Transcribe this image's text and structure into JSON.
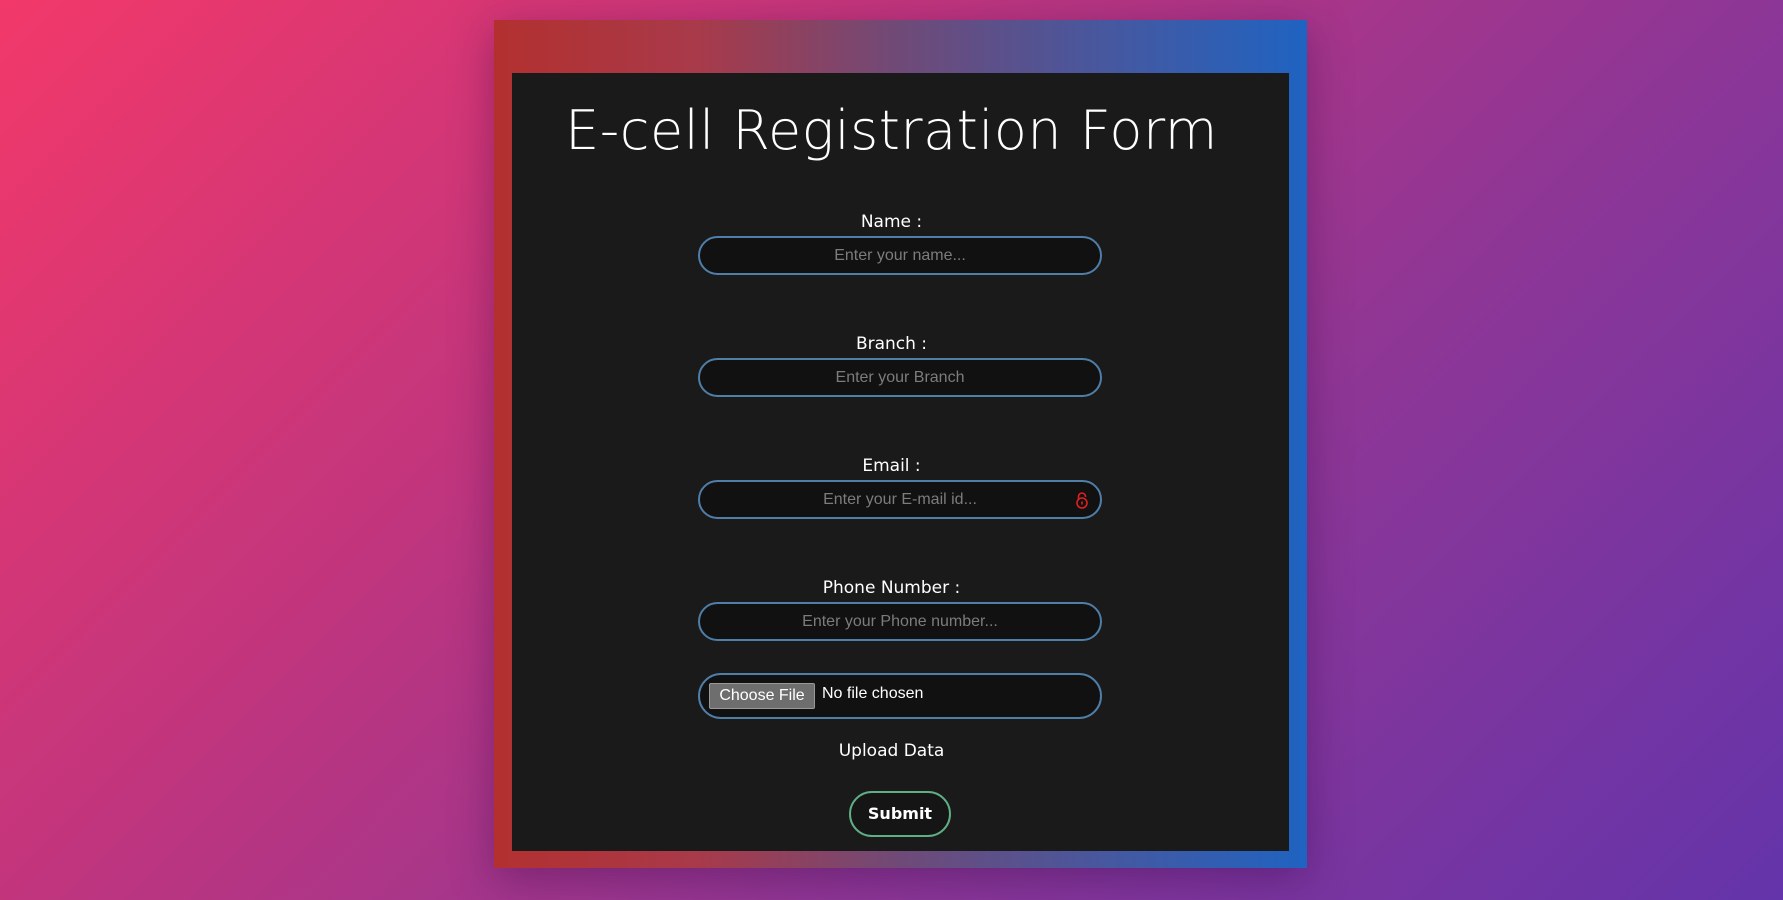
{
  "form": {
    "title": "E-cell Registration Form",
    "fields": [
      {
        "label": "Name :",
        "placeholder": "Enter your name..."
      },
      {
        "label": "Branch :",
        "placeholder": "Enter your Branch"
      },
      {
        "label": "Email :",
        "placeholder": "Enter your E-mail id..."
      },
      {
        "label": "Phone Number :",
        "placeholder": "Enter your Phone number..."
      }
    ],
    "file": {
      "button_label": "Choose File",
      "status": "No file chosen"
    },
    "upload_label": "Upload Data",
    "submit_label": "Submit"
  },
  "colors": {
    "card_background": "#1a1a1a",
    "input_border": "#4f7ea8",
    "submit_border": "#5fae86",
    "lock_icon": "#e02020"
  },
  "icons": {
    "email_field_icon": "lock-icon"
  }
}
